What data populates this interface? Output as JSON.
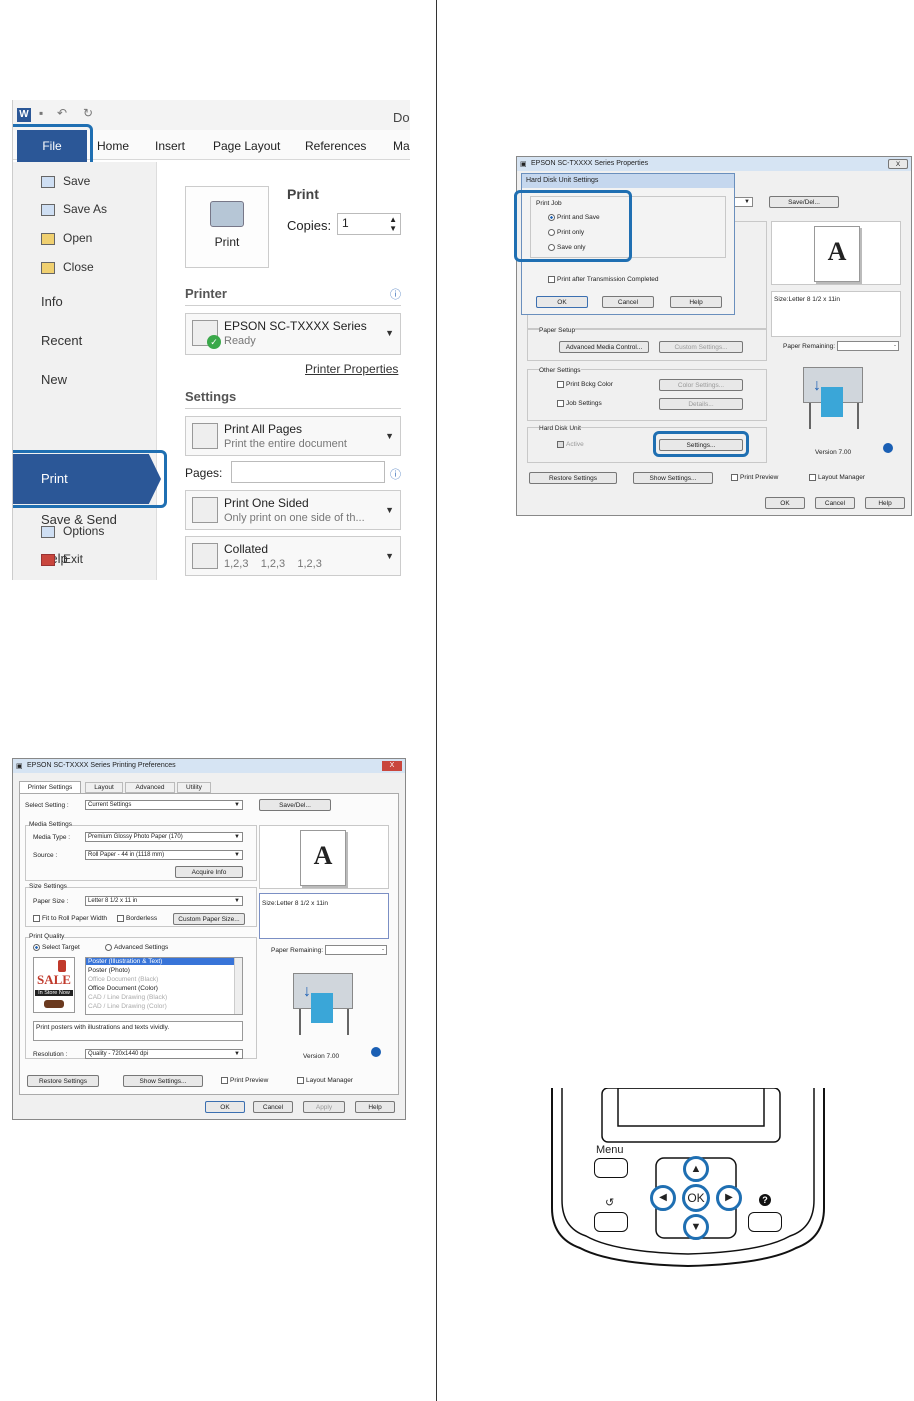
{
  "word": {
    "title_fragment": "Do",
    "tabs": [
      "File",
      "Home",
      "Insert",
      "Page Layout",
      "References",
      "Ma"
    ],
    "nav_small": [
      "Save",
      "Save As",
      "Open",
      "Close"
    ],
    "nav_big": [
      "Info",
      "Recent",
      "New",
      "Print",
      "Save & Send",
      "Help"
    ],
    "nav_bottom": [
      "Options",
      "Exit"
    ],
    "print_heading": "Print",
    "print_button": "Print",
    "copies_label": "Copies:",
    "copies_value": "1",
    "printer_heading": "Printer",
    "printer_name": "EPSON SC-TXXXX Series",
    "printer_status": "Ready",
    "printer_properties": "Printer Properties",
    "settings_heading": "Settings",
    "setting1_title": "Print All Pages",
    "setting1_sub": "Print the entire document",
    "pages_label": "Pages:",
    "setting2_title": "Print One Sided",
    "setting2_sub": "Only print on one side of th...",
    "setting3_title": "Collated",
    "setting3_sub": "1,2,3    1,2,3    1,2,3"
  },
  "props": {
    "title": "EPSON SC-TXXXX Series Properties",
    "close": "X",
    "hdd_title": "Hard Disk Unit Settings",
    "print_job": "Print Job",
    "opt_print_and_save": "Print and Save",
    "opt_print_only": "Print only",
    "opt_save_only": "Save only",
    "print_after": "Print after Transmission Completed",
    "ok": "OK",
    "cancel": "Cancel",
    "help": "Help",
    "save_del": "Save/Del...",
    "size_info": "Size:Letter 8 1/2 x 11in",
    "paper_setup": "Paper Setup",
    "adv_media": "Advanced Media Control...",
    "custom_settings": "Custom Settings...",
    "paper_remaining": "Paper Remaining:",
    "other_settings": "Other Settings",
    "print_bckg": "Print Bckg Color",
    "color_settings": "Color Settings...",
    "job_settings": "Job Settings",
    "details": "Details...",
    "hdd_unit": "Hard Disk Unit",
    "active": "Active",
    "settings_btn": "Settings...",
    "version": "Version 7.00",
    "restore": "Restore Settings",
    "show_settings": "Show Settings...",
    "print_preview": "Print Preview",
    "layout_manager": "Layout Manager",
    "ok2": "OK",
    "cancel2": "Cancel",
    "help2": "Help",
    "letter_glyph": "A"
  },
  "prefs": {
    "title": "EPSON SC-TXXXX Series Printing Preferences",
    "close": "X",
    "tabs": [
      "Printer Settings",
      "Layout",
      "Advanced",
      "Utility"
    ],
    "select_setting": "Select Setting :",
    "current_settings": "Current Settings",
    "save_del": "Save/Del...",
    "media_settings": "Media Settings",
    "media_type_label": "Media Type :",
    "media_type": "Premium Glossy Photo Paper (170)",
    "source_label": "Source :",
    "source": "Roll Paper - 44 in (1118 mm)",
    "acquire_info": "Acquire Info",
    "size_settings": "Size Settings",
    "paper_size_label": "Paper Size :",
    "paper_size": "Letter 8 1/2 x 11 in",
    "fit_roll": "Fit to Roll Paper Width",
    "borderless": "Borderless",
    "custom_paper": "Custom Paper Size...",
    "size_info": "Size:Letter 8 1/2 x 11in",
    "print_quality": "Print Quality",
    "select_target": "Select Target",
    "advanced_settings": "Advanced Settings",
    "targets": [
      "Poster (Illustration & Text)",
      "Poster (Photo)",
      "Office Document (Black)",
      "Office Document (Color)",
      "CAD / Line Drawing (Black)",
      "CAD / Line Drawing (Color)"
    ],
    "sale_text": "SALE",
    "in_store": "In Store Now",
    "description": "Print posters with illustrations and texts vividly.",
    "resolution_label": "Resolution :",
    "resolution": "Quality - 720x1440 dpi",
    "paper_remaining": "Paper Remaining:",
    "version": "Version 7.00",
    "restore": "Restore Settings",
    "show_settings": "Show Settings...",
    "print_preview": "Print Preview",
    "layout_manager": "Layout Manager",
    "ok": "OK",
    "cancel": "Cancel",
    "apply": "Apply",
    "help": "Help",
    "letter_glyph": "A"
  },
  "panel": {
    "menu": "Menu",
    "ok": "OK",
    "back_glyph": "↺",
    "help_glyph": "?",
    "up": "▲",
    "down": "▼",
    "left": "◀",
    "right": "▶"
  },
  "colors": {
    "accent": "#1f6fb2",
    "word_blue": "#2b5797"
  }
}
